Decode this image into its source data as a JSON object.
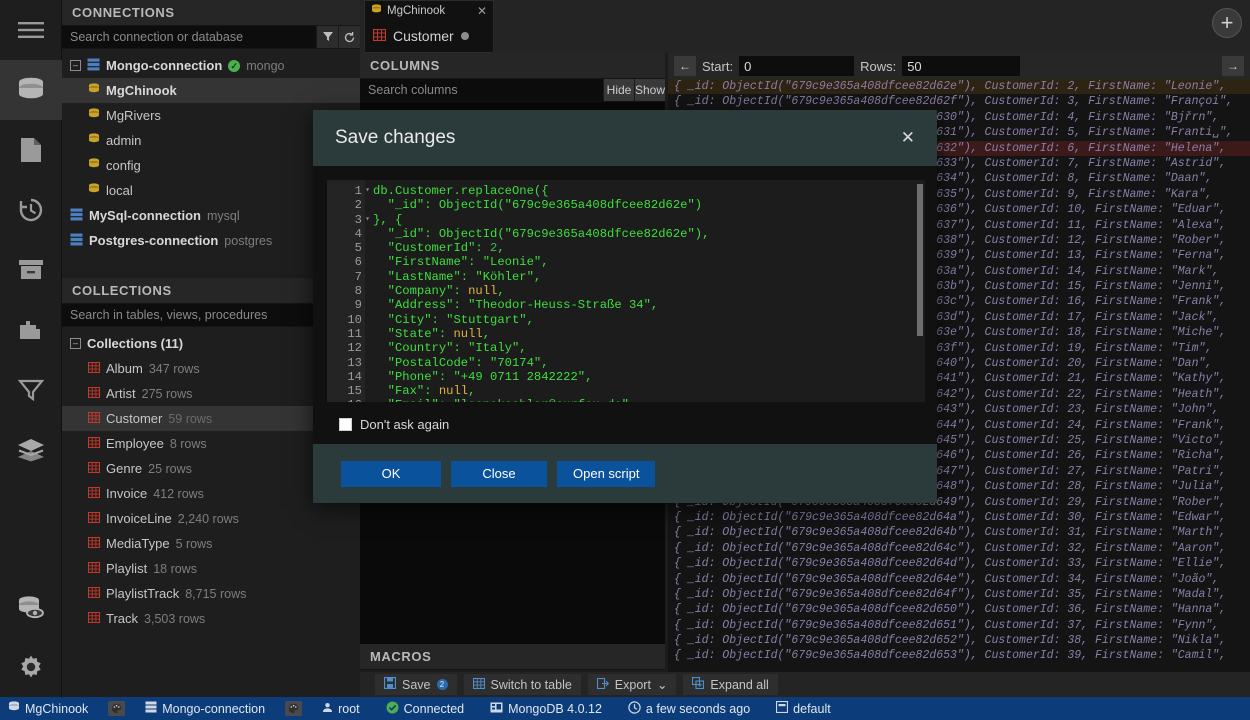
{
  "rail": {
    "items": [
      {
        "name": "menu-icon",
        "active": false
      },
      {
        "name": "database-icon",
        "active": true
      },
      {
        "name": "document-icon",
        "active": false
      },
      {
        "name": "history-icon",
        "active": false
      },
      {
        "name": "archive-icon",
        "active": false
      },
      {
        "name": "puzzle-icon",
        "active": false
      },
      {
        "name": "funnel-icon",
        "active": false
      },
      {
        "name": "layers-icon",
        "active": false
      }
    ],
    "bottom": [
      {
        "name": "database-inspect-icon"
      },
      {
        "name": "settings-gear-icon"
      }
    ]
  },
  "connections": {
    "title": "CONNECTIONS",
    "search_placeholder": "Search connection or database",
    "search_value": "",
    "filter_icon": "funnel-icon",
    "refresh_icon": "refresh-icon",
    "tree": [
      {
        "label": "Mongo-connection",
        "sub": "mongo",
        "level": 0,
        "kind": "server",
        "expanded": true,
        "status": "ok",
        "selected": false
      },
      {
        "label": "MgChinook",
        "sub": "",
        "level": 1,
        "kind": "db",
        "selected": true
      },
      {
        "label": "MgRivers",
        "sub": "",
        "level": 1,
        "kind": "db",
        "selected": false
      },
      {
        "label": "admin",
        "sub": "",
        "level": 1,
        "kind": "db",
        "selected": false
      },
      {
        "label": "config",
        "sub": "",
        "level": 1,
        "kind": "db",
        "selected": false
      },
      {
        "label": "local",
        "sub": "",
        "level": 1,
        "kind": "db",
        "selected": false
      },
      {
        "label": "MySql-connection",
        "sub": "mysql",
        "level": 0,
        "kind": "server",
        "expanded": false,
        "selected": false
      },
      {
        "label": "Postgres-connection",
        "sub": "postgres",
        "level": 0,
        "kind": "server",
        "expanded": false,
        "selected": false
      }
    ]
  },
  "collections": {
    "title": "COLLECTIONS",
    "search_placeholder": "Search in tables, views, procedures",
    "search_value": "",
    "filter_icon": "funnel-icon",
    "root_label": "Collections (11)",
    "items": [
      {
        "label": "Album",
        "rows": "347 rows",
        "selected": false
      },
      {
        "label": "Artist",
        "rows": "275 rows",
        "selected": false
      },
      {
        "label": "Customer",
        "rows": "59 rows",
        "selected": true
      },
      {
        "label": "Employee",
        "rows": "8 rows",
        "selected": false
      },
      {
        "label": "Genre",
        "rows": "25 rows",
        "selected": false
      },
      {
        "label": "Invoice",
        "rows": "412 rows",
        "selected": false
      },
      {
        "label": "InvoiceLine",
        "rows": "2,240 rows",
        "selected": false
      },
      {
        "label": "MediaType",
        "rows": "5 rows",
        "selected": false
      },
      {
        "label": "Playlist",
        "rows": "18 rows",
        "selected": false
      },
      {
        "label": "PlaylistTrack",
        "rows": "8,715 rows",
        "selected": false
      },
      {
        "label": "Track",
        "rows": "3,503 rows",
        "selected": false
      }
    ]
  },
  "tabs": {
    "db_tab": "MgChinook",
    "db_tab_close": "✕",
    "collection_tab": "Customer",
    "add_tab_icon": "plus-icon"
  },
  "columns_panel": {
    "title": "COLUMNS",
    "search_placeholder": "Search columns",
    "search_value": "",
    "hide_label": "Hide",
    "show_label": "Show"
  },
  "macros_panel": {
    "title": "MACROS"
  },
  "data_toolbar": {
    "back_icon": "arrow-left-icon",
    "forward_icon": "arrow-right-icon",
    "start_label": "Start:",
    "start_value": "0",
    "rows_label": "Rows:",
    "rows_value": "50"
  },
  "data_rows": [
    {
      "id": "679c9e365a408dfcee82d62e",
      "customer_id": "2",
      "first_name": "Leonie",
      "highlight": "a"
    },
    {
      "id": "679c9e365a408dfcee82d62f",
      "customer_id": "3",
      "first_name": "Françoi",
      "highlight": ""
    },
    {
      "id": "679c9e365a408dfcee82d630",
      "customer_id": "4",
      "first_name": "Bjřrn",
      "highlight": ""
    },
    {
      "id": "679c9e365a408dfcee82d631",
      "customer_id": "5",
      "first_name": "Franti␣",
      "highlight": ""
    },
    {
      "id": "679c9e365a408dfcee82d632",
      "customer_id": "6",
      "first_name": "Helena",
      "highlight": "b"
    },
    {
      "id": "679c9e365a408dfcee82d633",
      "customer_id": "7",
      "first_name": "Astrid",
      "highlight": ""
    },
    {
      "id": "679c9e365a408dfcee82d634",
      "customer_id": "8",
      "first_name": "Daan",
      "highlight": ""
    },
    {
      "id": "679c9e365a408dfcee82d635",
      "customer_id": "9",
      "first_name": "Kara",
      "highlight": ""
    },
    {
      "id": "679c9e365a408dfcee82d636",
      "customer_id": "10",
      "first_name": "Eduar",
      "highlight": ""
    },
    {
      "id": "679c9e365a408dfcee82d637",
      "customer_id": "11",
      "first_name": "Alexa",
      "highlight": ""
    },
    {
      "id": "679c9e365a408dfcee82d638",
      "customer_id": "12",
      "first_name": "Rober",
      "highlight": ""
    },
    {
      "id": "679c9e365a408dfcee82d639",
      "customer_id": "13",
      "first_name": "Ferna",
      "highlight": ""
    },
    {
      "id": "679c9e365a408dfcee82d63a",
      "customer_id": "14",
      "first_name": "Mark",
      "highlight": ""
    },
    {
      "id": "679c9e365a408dfcee82d63b",
      "customer_id": "15",
      "first_name": "Jenni",
      "highlight": ""
    },
    {
      "id": "679c9e365a408dfcee82d63c",
      "customer_id": "16",
      "first_name": "Frank",
      "highlight": ""
    },
    {
      "id": "679c9e365a408dfcee82d63d",
      "customer_id": "17",
      "first_name": "Jack",
      "highlight": ""
    },
    {
      "id": "679c9e365a408dfcee82d63e",
      "customer_id": "18",
      "first_name": "Miche",
      "highlight": ""
    },
    {
      "id": "679c9e365a408dfcee82d63f",
      "customer_id": "19",
      "first_name": "Tim",
      "highlight": ""
    },
    {
      "id": "679c9e365a408dfcee82d640",
      "customer_id": "20",
      "first_name": "Dan",
      "highlight": ""
    },
    {
      "id": "679c9e365a408dfcee82d641",
      "customer_id": "21",
      "first_name": "Kathy",
      "highlight": ""
    },
    {
      "id": "679c9e365a408dfcee82d642",
      "customer_id": "22",
      "first_name": "Heath",
      "highlight": ""
    },
    {
      "id": "679c9e365a408dfcee82d643",
      "customer_id": "23",
      "first_name": "John",
      "highlight": ""
    },
    {
      "id": "679c9e365a408dfcee82d644",
      "customer_id": "24",
      "first_name": "Frank",
      "highlight": ""
    },
    {
      "id": "679c9e365a408dfcee82d645",
      "customer_id": "25",
      "first_name": "Victo",
      "highlight": ""
    },
    {
      "id": "679c9e365a408dfcee82d646",
      "customer_id": "26",
      "first_name": "Richa",
      "highlight": ""
    },
    {
      "id": "679c9e365a408dfcee82d647",
      "customer_id": "27",
      "first_name": "Patri",
      "highlight": ""
    },
    {
      "id": "679c9e365a408dfcee82d648",
      "customer_id": "28",
      "first_name": "Julia",
      "highlight": ""
    },
    {
      "id": "679c9e365a408dfcee82d649",
      "customer_id": "29",
      "first_name": "Rober",
      "highlight": ""
    },
    {
      "id": "679c9e365a408dfcee82d64a",
      "customer_id": "30",
      "first_name": "Edwar",
      "highlight": ""
    },
    {
      "id": "679c9e365a408dfcee82d64b",
      "customer_id": "31",
      "first_name": "Marth",
      "highlight": ""
    },
    {
      "id": "679c9e365a408dfcee82d64c",
      "customer_id": "32",
      "first_name": "Aaron",
      "highlight": ""
    },
    {
      "id": "679c9e365a408dfcee82d64d",
      "customer_id": "33",
      "first_name": "Ellie",
      "highlight": ""
    },
    {
      "id": "679c9e365a408dfcee82d64e",
      "customer_id": "34",
      "first_name": "João",
      "highlight": ""
    },
    {
      "id": "679c9e365a408dfcee82d64f",
      "customer_id": "35",
      "first_name": "Madal",
      "highlight": ""
    },
    {
      "id": "679c9e365a408dfcee82d650",
      "customer_id": "36",
      "first_name": "Hanna",
      "highlight": ""
    },
    {
      "id": "679c9e365a408dfcee82d651",
      "customer_id": "37",
      "first_name": "Fynn",
      "highlight": ""
    },
    {
      "id": "679c9e365a408dfcee82d652",
      "customer_id": "38",
      "first_name": "Nikla",
      "highlight": ""
    },
    {
      "id": "679c9e365a408dfcee82d653",
      "customer_id": "39",
      "first_name": "Camil",
      "highlight": ""
    }
  ],
  "bottom_toolbar": {
    "save_label": "Save",
    "save_icon": "save-icon",
    "save_badge": "2",
    "switch_label": "Switch to table",
    "switch_icon": "table-icon",
    "export_label": "Export",
    "export_icon": "export-icon",
    "export_caret": "⌄",
    "expand_label": "Expand all",
    "expand_icon": "expand-icon"
  },
  "status_bar": {
    "database": "MgChinook",
    "database_icon": "database-icon",
    "theme_icon_1": "palette-icon",
    "connection": "Mongo-connection",
    "connection_icon": "server-icon",
    "theme_icon_2": "palette-icon",
    "user": "root",
    "user_icon": "user-icon",
    "connected": "Connected",
    "connected_icon": "check-circle-icon",
    "server_version": "MongoDB 4.0.12",
    "server_icon": "server-chip-icon",
    "refreshed": "a few seconds ago",
    "clock_icon": "clock-icon",
    "profile": "default",
    "profile_icon": "window-icon"
  },
  "modal": {
    "title": "Save changes",
    "close_icon": "✕",
    "dont_ask_label": "Don't ask again",
    "dont_ask_checked": false,
    "ok_label": "OK",
    "close_label": "Close",
    "open_script_label": "Open script",
    "script_lines": [
      {
        "n": "1",
        "fold": true,
        "text": "db.Customer.replaceOne({"
      },
      {
        "n": "2",
        "fold": false,
        "text": "  \"_id\": ObjectId(\"679c9e365a408dfcee82d62e\")"
      },
      {
        "n": "3",
        "fold": true,
        "text": "}, {"
      },
      {
        "n": "4",
        "fold": false,
        "text": "  \"_id\": ObjectId(\"679c9e365a408dfcee82d62e\"),"
      },
      {
        "n": "5",
        "fold": false,
        "text": "  \"CustomerId\": 2,"
      },
      {
        "n": "6",
        "fold": false,
        "text": "  \"FirstName\": \"Leonie\","
      },
      {
        "n": "7",
        "fold": false,
        "text": "  \"LastName\": \"Köhler\","
      },
      {
        "n": "8",
        "fold": false,
        "text": "  \"Company\": null,"
      },
      {
        "n": "9",
        "fold": false,
        "text": "  \"Address\": \"Theodor-Heuss-Straße 34\","
      },
      {
        "n": "10",
        "fold": false,
        "text": "  \"City\": \"Stuttgart\","
      },
      {
        "n": "11",
        "fold": false,
        "text": "  \"State\": null,"
      },
      {
        "n": "12",
        "fold": false,
        "text": "  \"Country\": \"Italy\","
      },
      {
        "n": "13",
        "fold": false,
        "text": "  \"PostalCode\": \"70174\","
      },
      {
        "n": "14",
        "fold": false,
        "text": "  \"Phone\": \"+49 0711 2842222\","
      },
      {
        "n": "15",
        "fold": false,
        "text": "  \"Fax\": null,"
      },
      {
        "n": "16",
        "fold": false,
        "text": "  \"Email\": \"leonekoehler@surfeu.de\","
      }
    ]
  },
  "colors": {
    "accent_blue": "#0b529c",
    "status_bar": "#0c3d7a",
    "modal_header": "#2b3a3a",
    "table_icon": "#c0392b",
    "server_icon": "#4c7fbf",
    "ok_green": "#4caf50",
    "code_green": "#3fde3f"
  }
}
